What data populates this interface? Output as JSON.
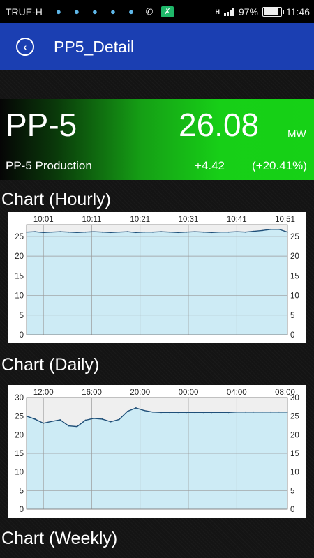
{
  "status_bar": {
    "carrier": "TRUE-H",
    "notification_icons": [
      "lightbulb-icon",
      "lightbulb-icon",
      "lightbulb-icon",
      "lightbulb-icon",
      "lightbulb-icon",
      "phone-icon",
      "shuffle-icon"
    ],
    "network": "H",
    "battery_percent": "97%",
    "battery_level": 0.97,
    "time": "11:46"
  },
  "app_bar": {
    "title": "PP5_Detail",
    "back_icon": "back-arrow-icon"
  },
  "summary": {
    "name": "PP-5",
    "value": "26.08",
    "unit": "MW",
    "label": "PP-5 Production",
    "change": "+4.42",
    "change_pct": "(+20.41%)",
    "gradient_colors": [
      "#050505",
      "#17cf17"
    ]
  },
  "sections": {
    "hourly_title": "Chart (Hourly)",
    "daily_title": "Chart (Daily)",
    "weekly_title": "Chart (Weekly)"
  },
  "colors": {
    "fill": "#cdebf5",
    "line": "#1f4f78",
    "grid": "#9a9a9a"
  },
  "chart_data": [
    {
      "type": "area",
      "title": "Chart (Hourly)",
      "x_ticks": [
        "10:01",
        "10:11",
        "10:21",
        "10:31",
        "10:41",
        "10:51"
      ],
      "y_ticks": [
        0,
        5,
        10,
        15,
        20,
        25
      ],
      "ylim": [
        0,
        28
      ],
      "grid": true,
      "y": [
        26.1,
        26.2,
        26.0,
        26.1,
        26.2,
        26.1,
        26.0,
        26.1,
        26.2,
        26.1,
        26.0,
        26.1,
        26.2,
        26.0,
        26.1,
        26.1,
        26.2,
        26.1,
        26.0,
        26.1,
        26.2,
        26.1,
        26.0,
        26.1,
        26.1,
        26.2,
        26.1,
        26.3,
        26.5,
        26.8,
        26.8,
        26.1
      ]
    },
    {
      "type": "area",
      "title": "Chart (Daily)",
      "x_ticks": [
        "12:00",
        "16:00",
        "20:00",
        "00:00",
        "04:00",
        "08:00"
      ],
      "y_ticks": [
        0,
        5,
        10,
        15,
        20,
        25,
        30
      ],
      "ylim": [
        0,
        30
      ],
      "grid": true,
      "y": [
        25.0,
        24.2,
        23.1,
        23.6,
        24.0,
        22.4,
        22.2,
        23.9,
        24.4,
        24.2,
        23.5,
        24.1,
        26.3,
        27.2,
        26.5,
        26.1,
        26.0,
        26.0,
        26.0,
        26.0,
        26.0,
        26.0,
        26.0,
        26.0,
        26.0,
        26.1,
        26.1,
        26.1,
        26.1,
        26.1,
        26.1,
        26.1
      ]
    }
  ]
}
